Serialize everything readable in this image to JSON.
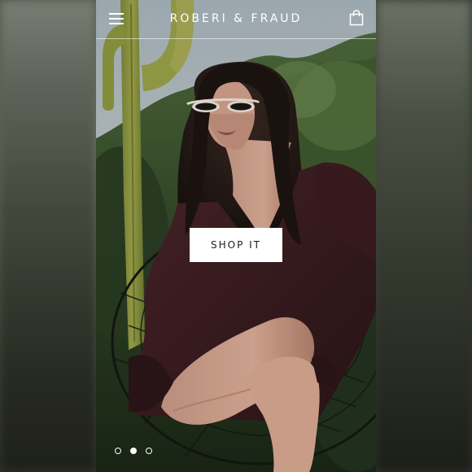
{
  "header": {
    "brand": "ROBERI & FRAUD",
    "menu_icon": "hamburger-menu-icon",
    "cart_icon": "shopping-bag-icon"
  },
  "hero": {
    "cta_label": "SHOP IT",
    "image_subject": "hero-photo"
  },
  "carousel": {
    "slide_count": 3,
    "active_index": 1
  },
  "colors": {
    "header_text": "#ffffff",
    "cta_background": "#ffffff",
    "cta_text": "#1b1b1b",
    "blazer": "#3a1e22"
  }
}
